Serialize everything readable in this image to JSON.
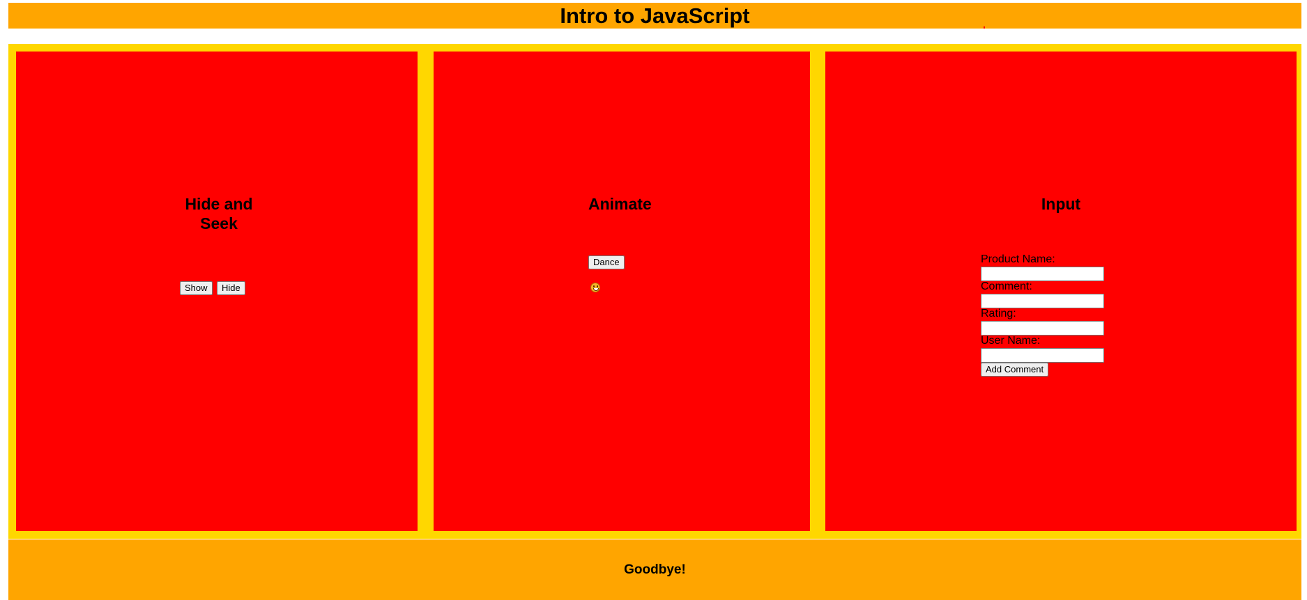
{
  "header": {
    "title": "Intro to JavaScript"
  },
  "panels": {
    "hide_and_seek": {
      "title": "Hide and Seek",
      "show_label": "Show",
      "hide_label": "Hide"
    },
    "animate": {
      "title": "Animate",
      "dance_label": "Dance",
      "emoji_icon": "smiley-face-icon"
    },
    "input": {
      "title": "Input",
      "fields": [
        {
          "label": "Product Name:",
          "value": ""
        },
        {
          "label": "Comment:",
          "value": ""
        },
        {
          "label": "Rating:",
          "value": ""
        },
        {
          "label": "User Name:",
          "value": ""
        }
      ],
      "submit_label": "Add Comment"
    }
  },
  "footer": {
    "text": "Goodbye!"
  },
  "colors": {
    "header_bg": "#ffa500",
    "main_bg": "#ffd700",
    "panel_bg": "#ff0000",
    "footer_bg": "#ffa500"
  }
}
